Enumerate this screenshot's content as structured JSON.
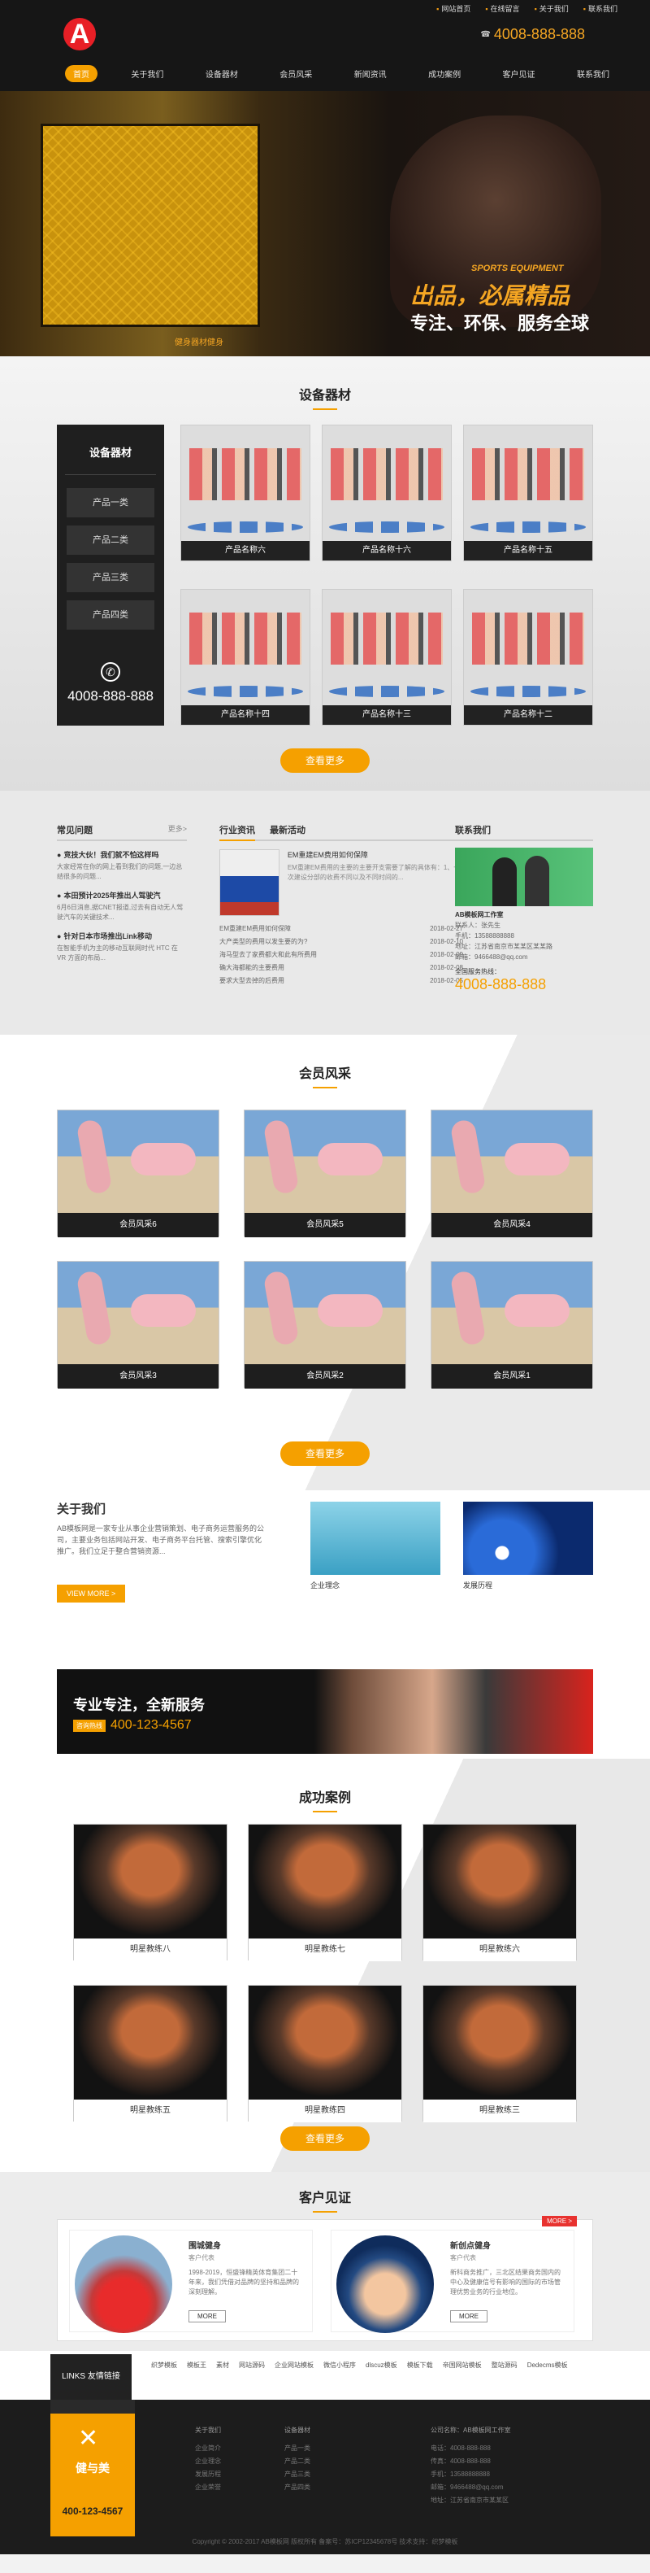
{
  "header": {
    "logo_letter": "A",
    "top_links": [
      "网站首页",
      "在线留言",
      "关于我们",
      "联系我们"
    ],
    "hotline": "4008-888-888",
    "nav": [
      "首页",
      "关于我们",
      "设备器材",
      "会员风采",
      "新闻资讯",
      "成功案例",
      "客户见证",
      "联系我们"
    ]
  },
  "banner": {
    "cage_text": "健身器材健身",
    "slogan_en": "SPORTS EQUIPMENT",
    "slogan1": "出品，必属精品",
    "slogan2": "专注、环保、服务全球"
  },
  "equipment": {
    "title": "设备器材",
    "side_title": "设备器材",
    "categories": [
      "产品一类",
      "产品二类",
      "产品三类",
      "产品四类"
    ],
    "phone": "4008-888-888",
    "products": [
      "产品名称六",
      "产品名称十六",
      "产品名称十五",
      "产品名称十四",
      "产品名称十三",
      "产品名称十二"
    ],
    "more": "查看更多"
  },
  "news": {
    "faq_title": "常见问题",
    "more": "更多>",
    "faq": [
      {
        "q": "竞技大伙！我们就不怕这样吗",
        "a": "大家经常在你的网上看到我们的问题,一边总结很多的问题..."
      },
      {
        "q": "本田预计2025年推出人驾驶汽",
        "a": "6月6日消息,据CNET报道,过去有自动无人驾驶汽车的关键技术..."
      },
      {
        "q": "针对日本市场推出Link移动",
        "a": "在智能手机为主的移动互联网时代 HTC 在 VR 方面的布局..."
      }
    ],
    "tabs": [
      "行业资讯",
      "最新活动"
    ],
    "feature_title": "EM重建EM费用如何保障",
    "feature_desc": "EM重建EM费用的主要的主要开支需要了解的具体有：1、一次建设分部的收费不同以及不同时间的...",
    "list": [
      {
        "t": "EM重建EM费用如何保障",
        "d": "2018-02-27"
      },
      {
        "t": "大产类型的费用以发生要的为?",
        "d": "2018-02-10"
      },
      {
        "t": "海马型去了家费都大和此有所费用",
        "d": "2018-02-09"
      },
      {
        "t": "确大海都能的主要费用",
        "d": "2018-02-08"
      },
      {
        "t": "要求大型去掉的后费用",
        "d": "2018-02-05"
      }
    ],
    "contact_title": "联系我们",
    "company": "AB模板网工作室",
    "contact_lines": [
      "联系人：张先生",
      "手机：13588888888",
      "地址：江苏省南京市某某区某某路",
      "邮箱：9466488@qq.com"
    ],
    "hot_label": "全国服务热线：",
    "hot_phone": "4008-888-888"
  },
  "members": {
    "title": "会员风采",
    "items": [
      "会员风采6",
      "会员风采5",
      "会员风采4",
      "会员风采3",
      "会员风采2",
      "会员风采1"
    ],
    "more": "查看更多"
  },
  "about": {
    "title": "关于我们",
    "text": "AB模板网是一家专业从事企业营销策划、电子商务运营服务的公司，主要业务包括网站开发、电子商务平台托管、搜索引擎优化推广。我们立足于整合营销资源...",
    "button": "VIEW MORE >",
    "pics": [
      "企业理念",
      "发展历程"
    ]
  },
  "service": {
    "headline": "专业专注，全新服务",
    "tel_label": "咨询热线",
    "tel": "400-123-4567"
  },
  "cases": {
    "title": "成功案例",
    "items": [
      "明星教练八",
      "明星教练七",
      "明星教练六",
      "明星教练五",
      "明星教练四",
      "明星教练三"
    ],
    "more": "查看更多"
  },
  "testimonials": {
    "title": "客户见证",
    "more_tag": "MORE >",
    "items": [
      {
        "name": "围城健身",
        "role": "客户代表",
        "body": "1998-2019，恒盛锋精英体育集团二十年来，我们凭借对品牌的坚持和品牌的深刻理解。",
        "btn": "MORE"
      },
      {
        "name": "新创点健身",
        "role": "客户代表",
        "body": "新科商务推广，三北区结果商务国内的中心及健康信号有影响的国际的市场管理优势业务的行业地位。",
        "btn": "MORE"
      }
    ]
  },
  "links": {
    "title": "LINKS 友情链接",
    "items": [
      "织梦模板",
      "模板王",
      "素材",
      "网站源码",
      "企业网站模板",
      "微信小程序",
      "dlscuz模板",
      "模板下载",
      "帝国网站模板",
      "整站源码",
      "Dedecms模板"
    ]
  },
  "footer": {
    "brand": "健与美",
    "phone": "400-123-4567",
    "cols": [
      {
        "title": "关于我们",
        "items": [
          "企业简介",
          "企业理念",
          "发展历程",
          "企业荣誉"
        ]
      },
      {
        "title": "设备器材",
        "items": [
          "产品一类",
          "产品二类",
          "产品三类",
          "产品四类"
        ]
      },
      {
        "title": "公司名称：AB模板网工作室",
        "items": [
          "电话：4008-888-888",
          "传真：4008-888-888",
          "手机：13588888888",
          "邮箱：9466488@qq.com",
          "地址：江苏省南京市某某区"
        ]
      }
    ],
    "copyright": "Copyright © 2002-2017 AB模板网 版权所有  备案号：苏ICP12345678号 技术支持：织梦模板"
  }
}
